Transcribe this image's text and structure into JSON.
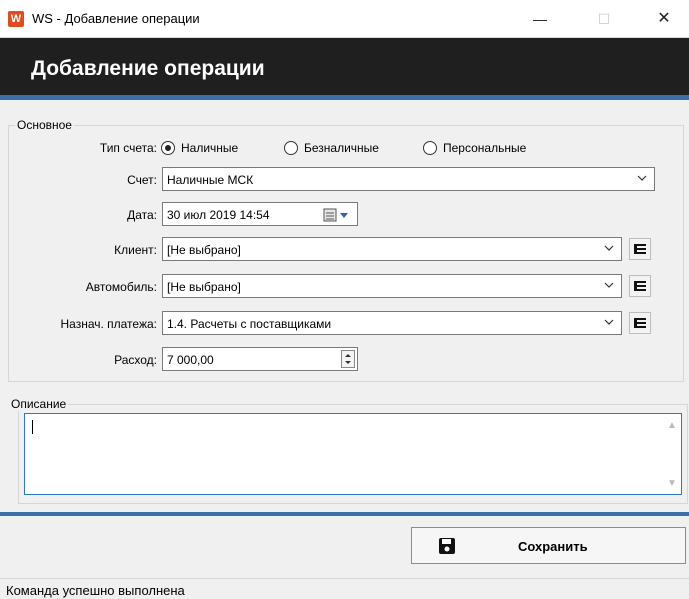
{
  "window": {
    "icon_letter": "W",
    "title": "WS - Добавление операции",
    "minimize": "—",
    "maximize": "☐",
    "close": "✕"
  },
  "header": {
    "title": "Добавление операции"
  },
  "main_group": {
    "legend": "Основное",
    "account_type": {
      "label": "Тип счета:",
      "options": [
        "Наличные",
        "Безналичные",
        "Персональные"
      ],
      "selected": "Наличные"
    },
    "account": {
      "label": "Счет:",
      "value": "Наличные МСК"
    },
    "date": {
      "label": "Дата:",
      "value": "30 июл 2019  14:54"
    },
    "client": {
      "label": "Клиент:",
      "value": "[Не выбрано]"
    },
    "car": {
      "label": "Автомобиль:",
      "value": "[Не выбрано]"
    },
    "purpose": {
      "label": "Назнач. платежа:",
      "value": "1.4. Расчеты с поставщиками"
    },
    "expense": {
      "label": "Расход:",
      "value": "7 000,00"
    }
  },
  "description": {
    "legend": "Описание",
    "value": ""
  },
  "actions": {
    "save_label": "Сохранить"
  },
  "status": {
    "text": "Команда успешно выполнена"
  },
  "colors": {
    "accent": "#3a6fa8",
    "header_bg": "#1f1f1f",
    "focus": "#2a79c9",
    "app_icon": "#e04b1f"
  }
}
